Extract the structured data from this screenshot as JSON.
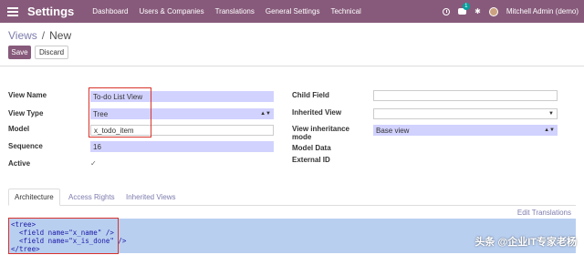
{
  "navbar": {
    "brand": "Settings",
    "menu": [
      "Dashboard",
      "Users & Companies",
      "Translations",
      "General Settings",
      "Technical"
    ],
    "chat_badge": "1",
    "user": "Mitchell Admin (demo)",
    "color": "#875a7b"
  },
  "breadcrumb": {
    "parent": "Views",
    "separator": "/",
    "current": "New"
  },
  "buttons": {
    "save": "Save",
    "discard": "Discard"
  },
  "form": {
    "left": {
      "view_name": {
        "label": "View Name",
        "value": "To-do List View"
      },
      "view_type": {
        "label": "View Type",
        "value": "Tree"
      },
      "model": {
        "label": "Model",
        "value": "x_todo_item"
      },
      "sequence": {
        "label": "Sequence",
        "value": "16"
      },
      "active": {
        "label": "Active",
        "checked": "✓"
      }
    },
    "right": {
      "child_field": {
        "label": "Child Field",
        "value": ""
      },
      "inherited_view": {
        "label": "Inherited View",
        "value": ""
      },
      "view_inheritance_mode": {
        "label_1": "View inheritance",
        "label_2": "mode",
        "value": "Base view"
      },
      "model_data": {
        "label": "Model Data"
      },
      "external_id": {
        "label": "External ID"
      }
    }
  },
  "tabs": [
    "Architecture",
    "Access Rights",
    "Inherited Views"
  ],
  "edit_translations": "Edit Translations",
  "code": [
    "<tree>",
    "  <field name=\"x_name\" />",
    "  <field name=\"x_is_done\" />",
    "</tree>"
  ],
  "watermark": "头条 @企业IT专家老杨"
}
